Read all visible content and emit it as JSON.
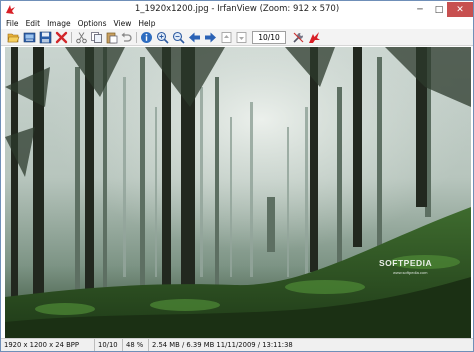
{
  "window": {
    "title": "1_1920x1200.jpg - IrfanView (Zoom: 912 x 570)",
    "minimize": "─",
    "maximize": "□",
    "close": "✕"
  },
  "menu": {
    "items": [
      "File",
      "Edit",
      "Image",
      "Options",
      "View",
      "Help"
    ]
  },
  "toolbar": {
    "page_counter": "10/10",
    "icons": [
      "open-folder-icon",
      "slideshow-icon",
      "save-icon",
      "delete-icon",
      "cut-icon",
      "copy-icon",
      "paste-icon",
      "undo-icon",
      "info-icon",
      "zoom-in-icon",
      "zoom-out-icon",
      "previous-icon",
      "next-icon",
      "first-page-icon",
      "last-page-icon",
      "settings-icon",
      "irfanview-cat-icon"
    ]
  },
  "image": {
    "watermark": "SOFTPEDIA",
    "watermark_sub": "www.softpedia.com"
  },
  "status": {
    "dimensions": "1920 x 1200 x 24 BPP",
    "index": "10/10",
    "zoom": "48 %",
    "file_info": "2.54 MB / 6.39 MB 11/11/2009 / 13:11:38"
  }
}
